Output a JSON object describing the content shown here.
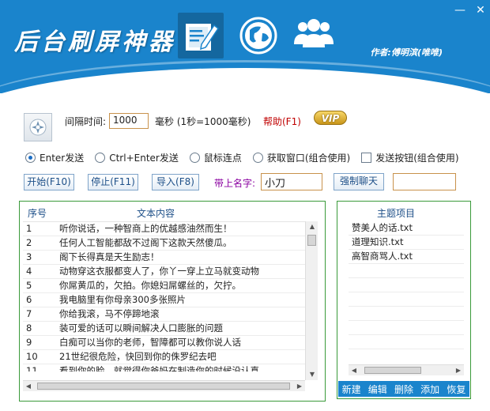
{
  "header": {
    "title": "后台刷屏神器",
    "author": "作者:傅明滨(唯唯)",
    "tools": [
      "edit-note-icon",
      "globe-icon",
      "users-icon"
    ],
    "colors": {
      "brand": "#1a84cc",
      "accent_green": "#3a9a3a"
    }
  },
  "window": {
    "minimize": "—",
    "close": "✕"
  },
  "settings": {
    "interval_label": "间隔时间:",
    "interval_value": "1000",
    "interval_unit": "毫秒 (1秒=1000毫秒)",
    "help": "帮助(F1)",
    "vip": "VIP"
  },
  "options": {
    "enter_send": "Enter发送",
    "ctrl_enter_send": "Ctrl+Enter发送",
    "mouse_click": "鼠标连点",
    "get_window": "获取窗口(组合使用)",
    "send_button": "发送按钮(组合使用)"
  },
  "buttons": {
    "start": "开始(F10)",
    "stop": "停止(F11)",
    "import": "导入(F8)",
    "name_label": "带上名字:",
    "name_value": "小刀",
    "force_chat": "强制聊天",
    "extra_value": ""
  },
  "messages": {
    "col_no": "序号",
    "col_text": "文本内容",
    "rows": [
      {
        "no": "1",
        "text": "听你说话，一种智商上的优越感油然而生！"
      },
      {
        "no": "2",
        "text": "任何人工智能都敌不过阁下这款天然傻瓜。"
      },
      {
        "no": "3",
        "text": "阁下长得真是天生励志！"
      },
      {
        "no": "4",
        "text": "动物穿这衣服都变人了，你丫一穿上立马就变动物"
      },
      {
        "no": "5",
        "text": "你屌黄瓜的，欠拍。你媳妇屌螺丝的，欠拧。"
      },
      {
        "no": "6",
        "text": "我电脑里有你母亲300多张照片"
      },
      {
        "no": "7",
        "text": "你给我滚，马不停蹄地滚"
      },
      {
        "no": "8",
        "text": "装可爱的话可以瞬间解决人口膨胀的问题"
      },
      {
        "no": "9",
        "text": "白痴可以当你的老师，智障都可以教你说人话"
      },
      {
        "no": "10",
        "text": "21世纪很危险，快回到你的侏罗纪去吧"
      },
      {
        "no": "11",
        "text": "看到你的脸，就觉得你爸妈在制造你的时候没认真。"
      }
    ]
  },
  "topics": {
    "header": "主题项目",
    "items": [
      "赞美人的话.txt",
      "道理知识.txt",
      "高智商骂人.txt"
    ],
    "actions": {
      "new": "新建",
      "edit": "编辑",
      "delete": "删除",
      "add": "添加",
      "restore": "恢复"
    }
  }
}
